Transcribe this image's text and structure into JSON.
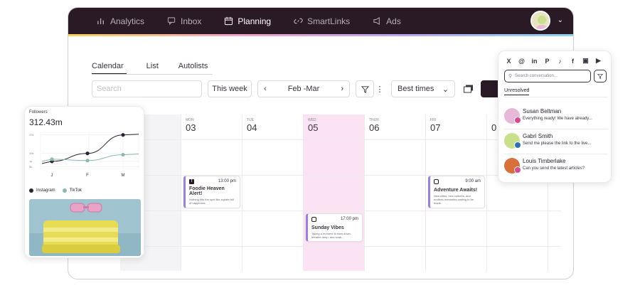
{
  "nav": {
    "items": [
      {
        "label": "Analytics",
        "icon": "bar-chart-icon",
        "active": false
      },
      {
        "label": "Inbox",
        "icon": "chat-icon",
        "active": false
      },
      {
        "label": "Planning",
        "icon": "calendar-icon",
        "active": true
      },
      {
        "label": "SmartLinks",
        "icon": "link-icon",
        "active": false
      },
      {
        "label": "Ads",
        "icon": "megaphone-icon",
        "active": false
      }
    ]
  },
  "tabs": [
    "Calendar",
    "List",
    "Autolists"
  ],
  "toolbar": {
    "search_placeholder": "Search",
    "this_week": "This week",
    "range": "Feb -Mar",
    "sort": "Best times"
  },
  "days": [
    {
      "name": "",
      "num": ""
    },
    {
      "name": "MON",
      "num": "03"
    },
    {
      "name": "TUE",
      "num": "04"
    },
    {
      "name": "WED",
      "num": "05"
    },
    {
      "name": "THUR",
      "num": "06"
    },
    {
      "name": "FRI",
      "num": "07"
    },
    {
      "name": "",
      "num": "0"
    }
  ],
  "posts": [
    {
      "time": "13:00 pm",
      "title": "Foodie Heaven Alert!",
      "desc": "Nothing hits the spot like a plate full of happiness"
    },
    {
      "time": "17:00 pm",
      "title": "Sunday Vibes",
      "desc": "Taking a moment to slow down, breathe deep, and soak..."
    },
    {
      "time": "9:00 am",
      "title": "Adventure Awaits!",
      "desc": "New cities, new cultures, and endless memories waiting to be made."
    }
  ],
  "followers": {
    "label": "Followers",
    "value": "312.43m",
    "yticks": [
      "17k",
      "10k",
      "7k",
      "5k"
    ],
    "months": [
      "J",
      "F",
      "M"
    ],
    "legend": [
      "Instagram",
      "TikTok"
    ]
  },
  "chart_data": {
    "type": "line",
    "categories": [
      "J",
      "F",
      "M"
    ],
    "series": [
      {
        "name": "Instagram",
        "color": "#2b2333",
        "values": [
          7.0,
          10.0,
          17.0
        ]
      },
      {
        "name": "TikTok",
        "color": "#8fb8b3",
        "values": [
          7.8,
          7.3,
          9.5
        ]
      }
    ]
  },
  "inbox": {
    "social_icons": [
      "X",
      "Threads",
      "in",
      "P",
      "TikTok",
      "f",
      "Instagram",
      "YouTube"
    ],
    "search_placeholder": "Search conversation...",
    "filter_label": "Unresolved",
    "conversations": [
      {
        "name": "Susan Beltman",
        "message": "Everything ready! We have already...",
        "badge_color": "#d54b8f",
        "avatar_color": "#e7b8d8"
      },
      {
        "name": "Gabri Smith",
        "message": "Send me please the link to the live...",
        "badge_color": "#2f6fb5",
        "avatar_color": "#c9e08a"
      },
      {
        "name": "Louis Timberlake",
        "message": "Can you send the latest articles?",
        "badge_color": "#d54b8f",
        "avatar_color": "#d9703a"
      }
    ]
  }
}
